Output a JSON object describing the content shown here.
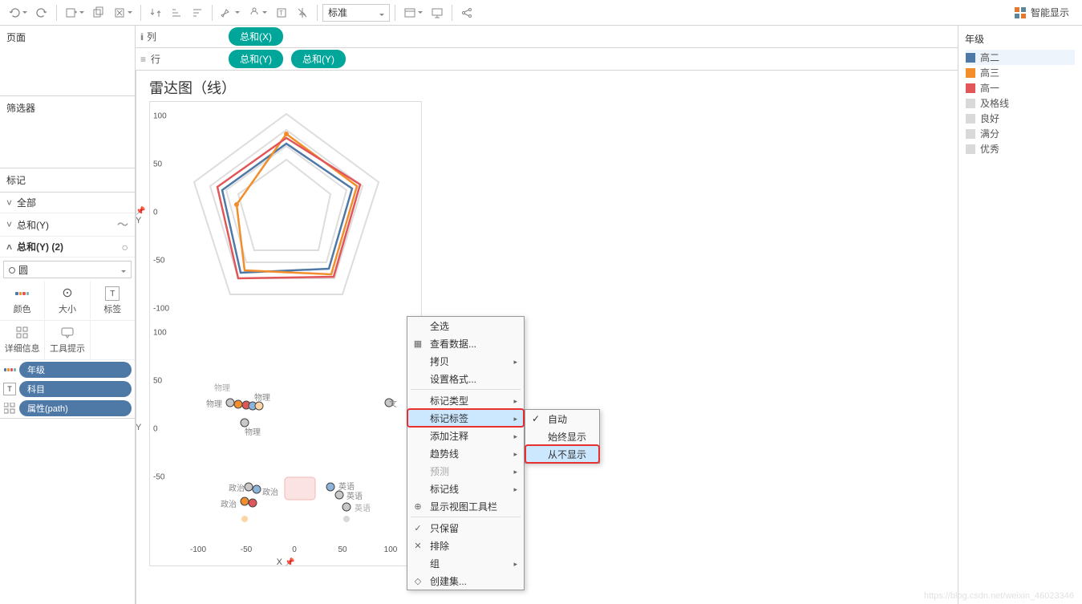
{
  "toolbar": {
    "format_select": "标准",
    "smart_show": "智能显示"
  },
  "panels": {
    "pages": "页面",
    "filters": "筛选器",
    "marks": "标记",
    "marks_items": {
      "all": "全部",
      "sum_y": "总和(Y)",
      "sum_y_2": "总和(Y) (2)",
      "shape_circle": "圆"
    },
    "mark_cells": {
      "color": "颜色",
      "size": "大小",
      "label": "标签",
      "detail": "详细信息",
      "tooltip": "工具提示"
    },
    "pills": {
      "grade": "年级",
      "subject": "科目",
      "path": "属性(path)"
    }
  },
  "shelves": {
    "columns_label": "列",
    "rows_label": "行",
    "col_pills": [
      "总和(X)"
    ],
    "row_pills": [
      "总和(Y)",
      "总和(Y)"
    ]
  },
  "chart": {
    "title": "雷达图（线）",
    "y_label": "Y",
    "x_label": "X",
    "y_ticks_top": [
      "100",
      "50",
      "0",
      "-50",
      "-100"
    ],
    "y_ticks_bottom": [
      "100",
      "50",
      "0",
      "-50"
    ],
    "x_ticks": [
      "-100",
      "-50",
      "0",
      "50",
      "100"
    ],
    "scatter_labels": [
      "物理",
      "物理",
      "物理",
      "物理",
      "语文",
      "政治",
      "政治",
      "政治",
      "英语",
      "英语",
      "英语"
    ]
  },
  "context_menu": {
    "items": [
      {
        "label": "全选",
        "icon": ""
      },
      {
        "label": "查看数据...",
        "icon": "▦"
      },
      {
        "label": "拷贝",
        "icon": "",
        "sub": true
      },
      {
        "label": "设置格式...",
        "icon": ""
      },
      {
        "sep": true
      },
      {
        "label": "标记类型",
        "icon": "",
        "sub": true
      },
      {
        "label": "标记标签",
        "icon": "",
        "sub": true,
        "hover": true,
        "ring": true
      },
      {
        "label": "添加注释",
        "icon": "",
        "sub": true
      },
      {
        "label": "趋势线",
        "icon": "",
        "sub": true
      },
      {
        "label": "预测",
        "icon": "",
        "sub": true,
        "disabled": true
      },
      {
        "label": "标记线",
        "icon": "",
        "sub": true
      },
      {
        "label": "显示视图工具栏",
        "icon": "⊕"
      },
      {
        "sep": true
      },
      {
        "label": "只保留",
        "icon": "✓"
      },
      {
        "label": "排除",
        "icon": "✕"
      },
      {
        "label": "组",
        "icon": "",
        "sub": true
      },
      {
        "label": "创建集...",
        "icon": "◇"
      }
    ],
    "sub_items": [
      {
        "label": "自动",
        "checked": true
      },
      {
        "label": "始终显示"
      },
      {
        "label": "从不显示",
        "hover": true,
        "ring": true
      }
    ]
  },
  "legend": {
    "title": "年级",
    "items": [
      {
        "label": "高二",
        "color": "#4e79a7",
        "sel": true
      },
      {
        "label": "高三",
        "color": "#f28e2b"
      },
      {
        "label": "高一",
        "color": "#e15759"
      },
      {
        "label": "及格线",
        "color": "#d9d9d9"
      },
      {
        "label": "良好",
        "color": "#d9d9d9"
      },
      {
        "label": "满分",
        "color": "#d9d9d9"
      },
      {
        "label": "优秀",
        "color": "#d9d9d9"
      }
    ]
  },
  "watermark": "https://blog.csdn.net/weixin_46023346",
  "chart_data": {
    "type": "scatter",
    "title": "雷达图（线）",
    "panels": [
      {
        "name": "radar_lines",
        "xlim": [
          -100,
          100
        ],
        "ylim": [
          -100,
          100
        ],
        "series": [
          {
            "name": "高二",
            "color": "#4e79a7"
          },
          {
            "name": "高三",
            "color": "#f28e2b"
          },
          {
            "name": "高一",
            "color": "#e15759"
          },
          {
            "name": "及格线",
            "color": "#d9d9d9"
          },
          {
            "name": "良好",
            "color": "#d9d9d9"
          },
          {
            "name": "满分",
            "color": "#d9d9d9"
          },
          {
            "name": "优秀",
            "color": "#d9d9d9"
          }
        ]
      },
      {
        "name": "radar_points",
        "xlim": [
          -100,
          100
        ],
        "ylim": [
          -100,
          100
        ],
        "points": [
          {
            "label": "物理",
            "x": -80,
            "y": 35
          },
          {
            "label": "物理",
            "x": -70,
            "y": 30
          },
          {
            "label": "物理",
            "x": -60,
            "y": 30
          },
          {
            "label": "物理",
            "x": -65,
            "y": 10
          },
          {
            "label": "语文",
            "x": 100,
            "y": 30
          },
          {
            "label": "政治",
            "x": -60,
            "y": -50
          },
          {
            "label": "政治",
            "x": -50,
            "y": -55
          },
          {
            "label": "政治",
            "x": -65,
            "y": -65
          },
          {
            "label": "英语",
            "x": 45,
            "y": -50
          },
          {
            "label": "英语",
            "x": 55,
            "y": -55
          },
          {
            "label": "英语",
            "x": 65,
            "y": -65
          }
        ]
      }
    ]
  }
}
